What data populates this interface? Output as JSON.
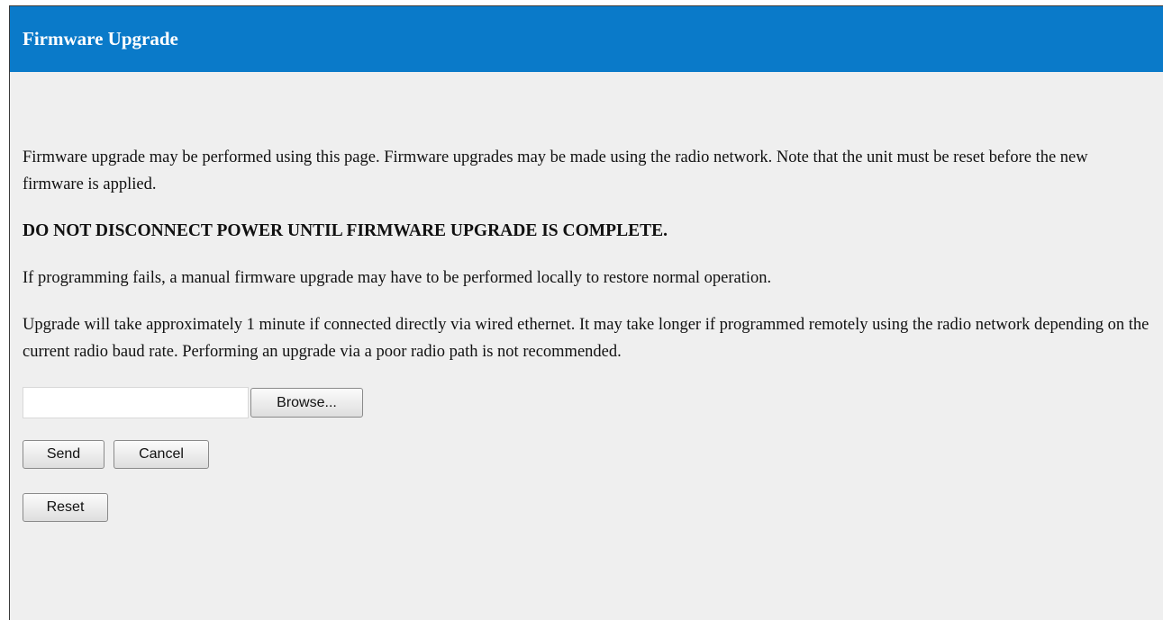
{
  "header": {
    "title": "Firmware Upgrade",
    "bg_color": "#0a7ac9"
  },
  "content": {
    "intro": "Firmware upgrade may be performed using this page. Firmware upgrades may be made using the radio network. Note that the unit must be reset before the new firmware is applied.",
    "warning": "DO NOT DISCONNECT POWER UNTIL FIRMWARE UPGRADE IS COMPLETE.",
    "failure_note": "If programming fails, a manual firmware upgrade may have to be performed locally to restore normal operation.",
    "time_note": "Upgrade will take approximately 1 minute if connected directly via wired ethernet. It may take longer if programmed remotely using the radio network depending on the current radio baud rate. Performing an upgrade via a poor radio path is not recommended."
  },
  "form": {
    "file_value": "",
    "browse_label": "Browse...",
    "send_label": "Send",
    "cancel_label": "Cancel",
    "reset_label": "Reset"
  }
}
